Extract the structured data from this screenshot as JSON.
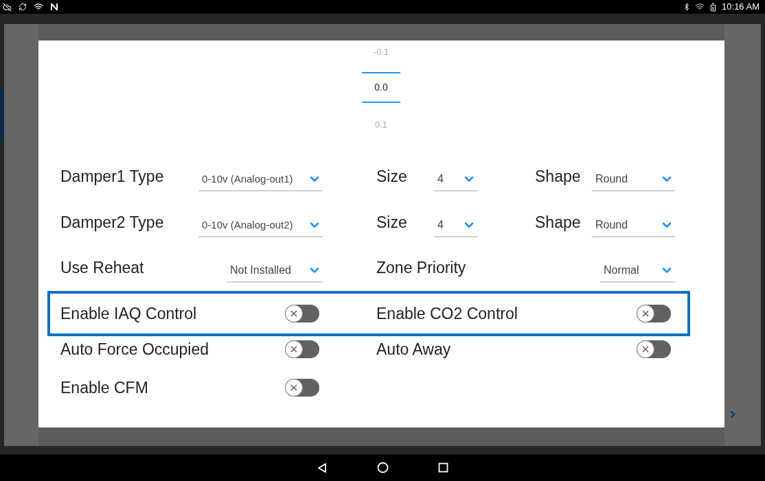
{
  "status_bar": {
    "time": "10:16 AM"
  },
  "picker": {
    "items": [
      {
        "value": "-0.1",
        "selected": false
      },
      {
        "value": "0.0",
        "selected": true
      },
      {
        "value": "0.1",
        "selected": false
      }
    ]
  },
  "dropdown_rows": [
    {
      "label": "Damper1 Type",
      "type_value": "0-10v (Analog-out1)",
      "size_label": "Size",
      "size_value": "4",
      "shape_label": "Shape",
      "shape_value": "Round"
    },
    {
      "label": "Damper2 Type",
      "type_value": "0-10v (Analog-out2)",
      "size_label": "Size",
      "size_value": "4",
      "shape_label": "Shape",
      "shape_value": "Round"
    }
  ],
  "reheat": {
    "label": "Use Reheat",
    "value": "Not Installed"
  },
  "zone_priority": {
    "label": "Zone Priority",
    "value": "Normal"
  },
  "toggle_rows": [
    {
      "highlighted": true,
      "items": [
        {
          "label": "Enable IAQ Control",
          "on": false
        },
        {
          "label": "Enable CO2 Control",
          "on": false
        }
      ]
    },
    {
      "highlighted": false,
      "items": [
        {
          "label": "Auto Force Occupied",
          "on": false
        },
        {
          "label": "Auto Away",
          "on": false
        }
      ]
    },
    {
      "highlighted": false,
      "items": [
        {
          "label": "Enable CFM",
          "on": false
        }
      ]
    }
  ]
}
